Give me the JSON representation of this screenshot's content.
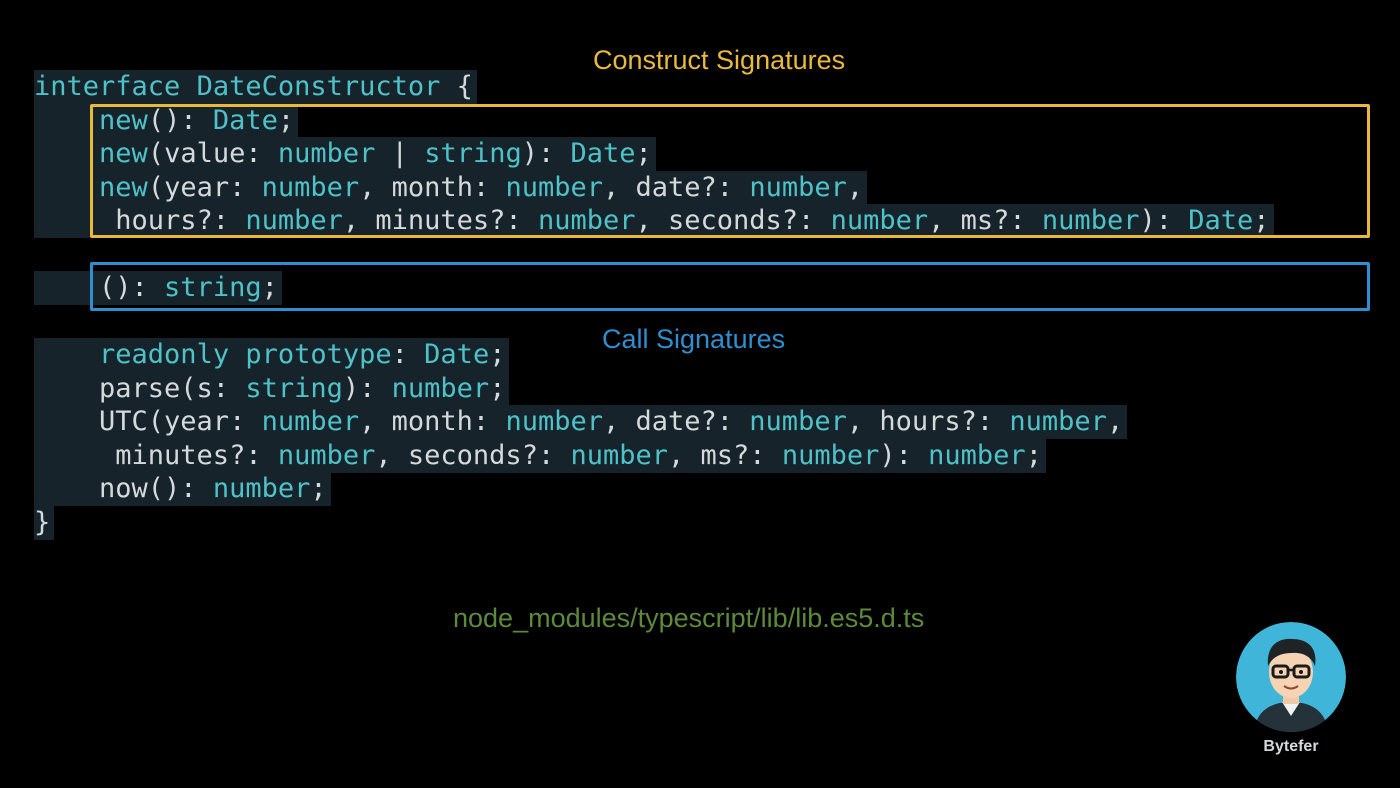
{
  "labels": {
    "construct": "Construct Signatures",
    "call": "Call Signatures",
    "file_path": "node_modules/typescript/lib/lib.es5.d.ts",
    "author": "Bytefer"
  },
  "colors": {
    "background": "#000000",
    "code_background": "#17232b",
    "keyword": "#4ec2c8",
    "type": "#4ec2c8",
    "punctuation": "#d4d9db",
    "construct_accent": "#e8b93a",
    "call_accent": "#2e8fd0",
    "path_text": "#5c8a3a",
    "avatar_bg": "#3fb6d9"
  },
  "code": {
    "lines": [
      {
        "id": "line-interface",
        "tokens": [
          {
            "t": "interface",
            "k": "kw"
          },
          {
            "t": " DateConstructor ",
            "k": "type"
          },
          {
            "t": "{",
            "k": "p"
          }
        ]
      },
      {
        "id": "line-new-empty",
        "tokens": [
          {
            "t": "    ",
            "k": "p"
          },
          {
            "t": "new",
            "k": "kw"
          },
          {
            "t": "(): ",
            "k": "p"
          },
          {
            "t": "Date",
            "k": "type"
          },
          {
            "t": ";",
            "k": "p"
          }
        ]
      },
      {
        "id": "line-new-value",
        "tokens": [
          {
            "t": "    ",
            "k": "p"
          },
          {
            "t": "new",
            "k": "kw"
          },
          {
            "t": "(value: ",
            "k": "p"
          },
          {
            "t": "number",
            "k": "type"
          },
          {
            "t": " | ",
            "k": "p"
          },
          {
            "t": "string",
            "k": "type"
          },
          {
            "t": "): ",
            "k": "p"
          },
          {
            "t": "Date",
            "k": "type"
          },
          {
            "t": ";",
            "k": "p"
          }
        ]
      },
      {
        "id": "line-new-year",
        "tokens": [
          {
            "t": "    ",
            "k": "p"
          },
          {
            "t": "new",
            "k": "kw"
          },
          {
            "t": "(year: ",
            "k": "p"
          },
          {
            "t": "number",
            "k": "type"
          },
          {
            "t": ", month: ",
            "k": "p"
          },
          {
            "t": "number",
            "k": "type"
          },
          {
            "t": ", date?: ",
            "k": "p"
          },
          {
            "t": "number",
            "k": "type"
          },
          {
            "t": ",",
            "k": "p"
          }
        ]
      },
      {
        "id": "line-new-hours",
        "tokens": [
          {
            "t": "     hours?: ",
            "k": "p"
          },
          {
            "t": "number",
            "k": "type"
          },
          {
            "t": ", minutes?: ",
            "k": "p"
          },
          {
            "t": "number",
            "k": "type"
          },
          {
            "t": ", seconds?: ",
            "k": "p"
          },
          {
            "t": "number",
            "k": "type"
          },
          {
            "t": ", ms?: ",
            "k": "p"
          },
          {
            "t": "number",
            "k": "type"
          },
          {
            "t": "): ",
            "k": "p"
          },
          {
            "t": "Date",
            "k": "type"
          },
          {
            "t": ";",
            "k": "p"
          }
        ]
      },
      {
        "id": "line-call",
        "tokens": [
          {
            "t": "    (): ",
            "k": "p"
          },
          {
            "t": "string",
            "k": "type"
          },
          {
            "t": ";",
            "k": "p"
          }
        ]
      },
      {
        "id": "line-prototype",
        "tokens": [
          {
            "t": "    ",
            "k": "p"
          },
          {
            "t": "readonly",
            "k": "kw"
          },
          {
            "t": " ",
            "k": "p"
          },
          {
            "t": "prototype",
            "k": "kw"
          },
          {
            "t": ": ",
            "k": "p"
          },
          {
            "t": "Date",
            "k": "type"
          },
          {
            "t": ";",
            "k": "p"
          }
        ]
      },
      {
        "id": "line-parse",
        "tokens": [
          {
            "t": "    parse(s: ",
            "k": "p"
          },
          {
            "t": "string",
            "k": "type"
          },
          {
            "t": "): ",
            "k": "p"
          },
          {
            "t": "number",
            "k": "type"
          },
          {
            "t": ";",
            "k": "p"
          }
        ]
      },
      {
        "id": "line-utc",
        "tokens": [
          {
            "t": "    UTC(year: ",
            "k": "p"
          },
          {
            "t": "number",
            "k": "type"
          },
          {
            "t": ", month: ",
            "k": "p"
          },
          {
            "t": "number",
            "k": "type"
          },
          {
            "t": ", date?: ",
            "k": "p"
          },
          {
            "t": "number",
            "k": "type"
          },
          {
            "t": ", hours?: ",
            "k": "p"
          },
          {
            "t": "number",
            "k": "type"
          },
          {
            "t": ",",
            "k": "p"
          }
        ]
      },
      {
        "id": "line-utc-cont",
        "tokens": [
          {
            "t": "     minutes?: ",
            "k": "p"
          },
          {
            "t": "number",
            "k": "type"
          },
          {
            "t": ", seconds?: ",
            "k": "p"
          },
          {
            "t": "number",
            "k": "type"
          },
          {
            "t": ", ms?: ",
            "k": "p"
          },
          {
            "t": "number",
            "k": "type"
          },
          {
            "t": "): ",
            "k": "p"
          },
          {
            "t": "number",
            "k": "type"
          },
          {
            "t": ";",
            "k": "p"
          }
        ]
      },
      {
        "id": "line-now",
        "tokens": [
          {
            "t": "    now(): ",
            "k": "p"
          },
          {
            "t": "number",
            "k": "type"
          },
          {
            "t": ";",
            "k": "p"
          }
        ]
      },
      {
        "id": "line-close",
        "tokens": [
          {
            "t": "}",
            "k": "p"
          }
        ]
      }
    ]
  }
}
